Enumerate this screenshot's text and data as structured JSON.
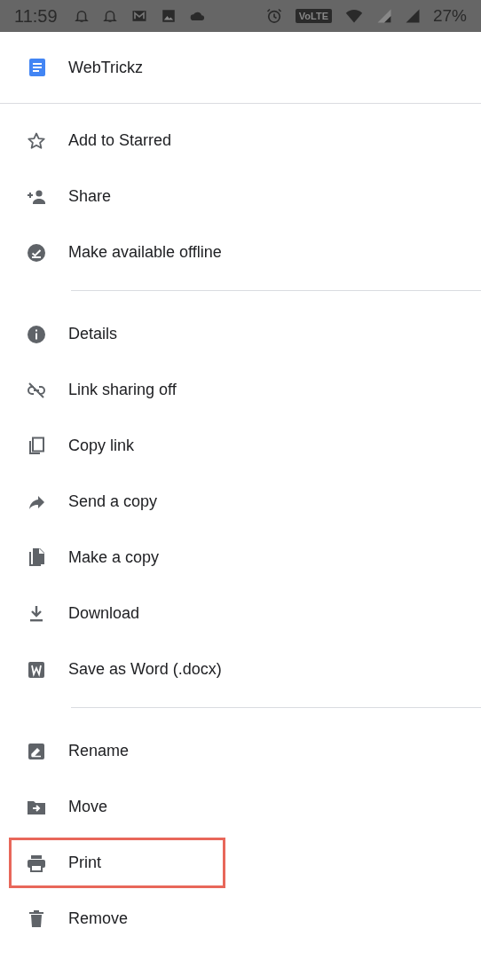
{
  "status_bar": {
    "time": "11:59",
    "network_badge": "VoLTE",
    "battery": "27%"
  },
  "document": {
    "title": "WebTrickz"
  },
  "sections": [
    [
      {
        "label": "Add to Starred",
        "highlighted": false
      },
      {
        "label": "Share",
        "highlighted": false
      },
      {
        "label": "Make available offline",
        "highlighted": false
      }
    ],
    [
      {
        "label": "Details",
        "highlighted": false
      },
      {
        "label": "Link sharing off",
        "highlighted": false
      },
      {
        "label": "Copy link",
        "highlighted": false
      },
      {
        "label": "Send a copy",
        "highlighted": false
      },
      {
        "label": "Make a copy",
        "highlighted": false
      },
      {
        "label": "Download",
        "highlighted": false
      },
      {
        "label": "Save as Word (.docx)",
        "highlighted": false
      }
    ],
    [
      {
        "label": "Rename",
        "highlighted": false
      },
      {
        "label": "Move",
        "highlighted": false
      },
      {
        "label": "Print",
        "highlighted": true
      },
      {
        "label": "Remove",
        "highlighted": false
      }
    ]
  ]
}
